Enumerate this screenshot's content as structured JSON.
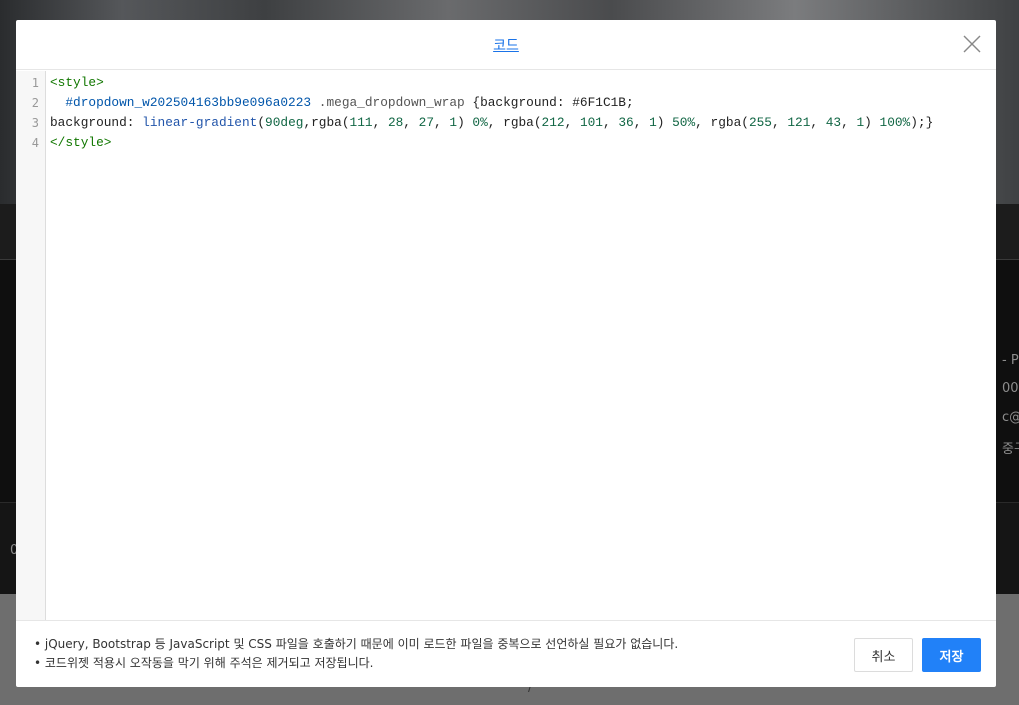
{
  "modal": {
    "title": "코드",
    "close_icon": "close-icon"
  },
  "editor": {
    "line_numbers": [
      "1",
      "2",
      "3",
      "4"
    ],
    "lines": [
      [
        {
          "t": "<style>",
          "c": "tag"
        }
      ],
      [
        {
          "t": "  #dropdown_w202504163bb9e096a0223",
          "c": "sel-id"
        },
        {
          "t": " .mega_dropdown_wrap ",
          "c": "sel-cls"
        },
        {
          "t": "{background: #6F1C1B;",
          "c": "val"
        }
      ],
      [
        {
          "t": "background: ",
          "c": "prop"
        },
        {
          "t": "linear-gradient",
          "c": "fn"
        },
        {
          "t": "(",
          "c": "val"
        },
        {
          "t": "90deg",
          "c": "num"
        },
        {
          "t": ",rgba(",
          "c": "val"
        },
        {
          "t": "111",
          "c": "num"
        },
        {
          "t": ", ",
          "c": "val"
        },
        {
          "t": "28",
          "c": "num"
        },
        {
          "t": ", ",
          "c": "val"
        },
        {
          "t": "27",
          "c": "num"
        },
        {
          "t": ", ",
          "c": "val"
        },
        {
          "t": "1",
          "c": "num"
        },
        {
          "t": ") ",
          "c": "val"
        },
        {
          "t": "0%",
          "c": "num"
        },
        {
          "t": ", rgba(",
          "c": "val"
        },
        {
          "t": "212",
          "c": "num"
        },
        {
          "t": ", ",
          "c": "val"
        },
        {
          "t": "101",
          "c": "num"
        },
        {
          "t": ", ",
          "c": "val"
        },
        {
          "t": "36",
          "c": "num"
        },
        {
          "t": ", ",
          "c": "val"
        },
        {
          "t": "1",
          "c": "num"
        },
        {
          "t": ") ",
          "c": "val"
        },
        {
          "t": "50%",
          "c": "num"
        },
        {
          "t": ", rgba(",
          "c": "val"
        },
        {
          "t": "255",
          "c": "num"
        },
        {
          "t": ", ",
          "c": "val"
        },
        {
          "t": "121",
          "c": "num"
        },
        {
          "t": ", ",
          "c": "val"
        },
        {
          "t": "43",
          "c": "num"
        },
        {
          "t": ", ",
          "c": "val"
        },
        {
          "t": "1",
          "c": "num"
        },
        {
          "t": ") ",
          "c": "val"
        },
        {
          "t": "100%",
          "c": "num"
        },
        {
          "t": ");}",
          "c": "val"
        }
      ],
      [
        {
          "t": "</style>",
          "c": "tag"
        }
      ]
    ]
  },
  "footer": {
    "notes": [
      "• jQuery, Bootstrap 등 JavaScript 및 CSS 파일을 호출하기 때문에 이미 로드한 파일을 중복으로 선언하실 필요가 없습니다.",
      "• 코드위젯 적용시 오작동을 막기 위해 주석은 제거되고 저장됩니다."
    ],
    "cancel_label": "취소",
    "save_label": "저장"
  },
  "background": {
    "fragments": [
      "- PM",
      "00",
      "c@g",
      "중구",
      "0",
      "/"
    ]
  },
  "colors": {
    "accent": "#2181f8",
    "title_link": "#1a73e8"
  }
}
